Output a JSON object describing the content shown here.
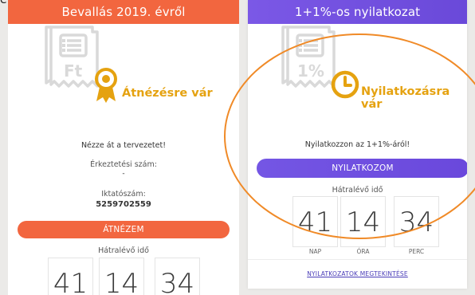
{
  "page": {
    "corner_text": "e"
  },
  "left_card": {
    "header_title": "Bevallás 2019. évről",
    "status_text": "Átnézésre vár",
    "instruction": "Nézze át a tervezetet!",
    "filing_number_label": "Érkeztetési szám:",
    "filing_number_value": "-",
    "registry_number_label": "Iktatószám:",
    "registry_number_value": "5259702559",
    "action_button": "ÁTNÉZEM",
    "timer_label": "Hátralévő idő",
    "timer": {
      "days": "41",
      "hours": "14",
      "minutes": "34"
    },
    "colors": {
      "header": "#f2663f",
      "status": "#e5a210"
    },
    "icons": {
      "document": "receipt-ft-icon",
      "status": "award-ribbon-icon"
    }
  },
  "right_card": {
    "header_title": "1+1%-os nyilatkozat",
    "status_text": "Nyilatkozásra vár",
    "instruction": "Nyilatkozzon az 1+1%-áról!",
    "action_button": "NYILATKOZOM",
    "timer_label": "Hátralévő idő",
    "timer": {
      "days": "41",
      "hours": "14",
      "minutes": "34"
    },
    "timer_units": {
      "days": "NAP",
      "hours": "ÓRA",
      "minutes": "PERC"
    },
    "link_text": "NYILATKOZATOK MEGTEKINTÉSE",
    "colors": {
      "header": "#7456e4",
      "status": "#e5a210"
    },
    "icons": {
      "document": "receipt-percent-icon",
      "status": "clock-icon"
    }
  },
  "overlay": {
    "color": "#f08a27"
  }
}
